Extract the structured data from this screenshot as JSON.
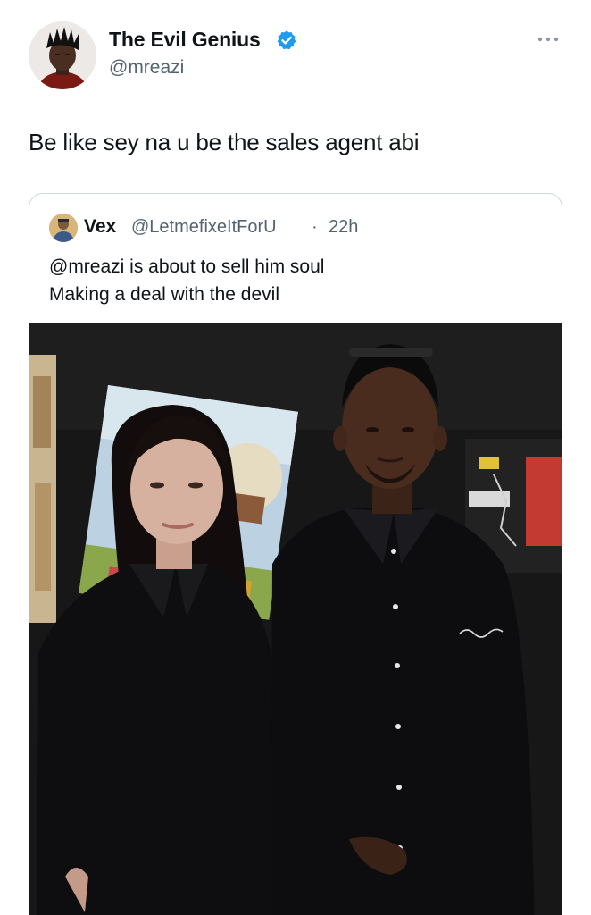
{
  "tweet": {
    "author": {
      "display_name": "The Evil Genius",
      "handle": "@mreazi",
      "verified": true
    },
    "text": "Be like sey na u be the sales agent abi",
    "more_icon": "more-horizontal-icon"
  },
  "quote": {
    "author": {
      "display_name": "Vex",
      "handle": "@LetmefixeItForU",
      "separator": "·",
      "time": "22h"
    },
    "text_lines": [
      "@mreazi is about to sell him soul",
      "Making a deal with the devil"
    ],
    "photo": {
      "shirt_logo": "Jacquemus"
    }
  },
  "colors": {
    "text_primary": "#0f1419",
    "text_secondary": "#536471",
    "verified_blue": "#1d9bf0",
    "border": "#cfd9de"
  }
}
